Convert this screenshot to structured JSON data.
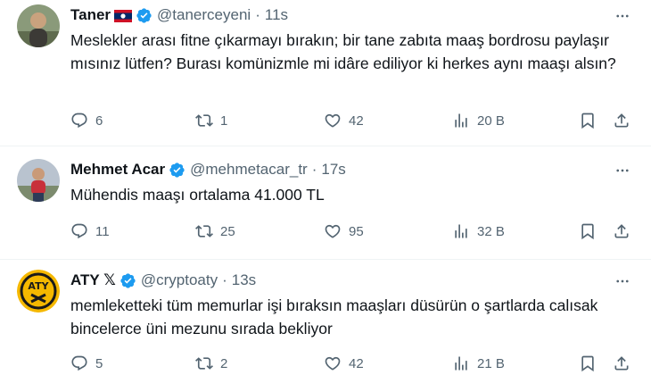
{
  "tweets": [
    {
      "name": "Taner",
      "handle": "@tanerceyeni",
      "time": "11s",
      "text": "Meslekler arası fitne çıkarmayı bırakın; bir tane zabıta maaş bordrosu paylaşır mısınız lütfen? Burası komünizmle mi idâre ediliyor ki herkes aynı maaşı alsın?",
      "replies": "6",
      "reposts": "1",
      "likes": "42",
      "views": "20 B"
    },
    {
      "name": "Mehmet Acar",
      "handle": "@mehmetacar_tr",
      "time": "17s",
      "text": "Mühendis maaşı ortalama 41.000 TL",
      "replies": "11",
      "reposts": "25",
      "likes": "95",
      "views": "32 B"
    },
    {
      "name": "ATY 𝕏",
      "handle": "@cryptoaty",
      "time": "13s",
      "text": "memleketteki tüm memurlar işi bıraksın maaşları düsürün o şartlarda calısak bincelerce üni mezunu sırada bekliyor",
      "replies": "5",
      "reposts": "2",
      "likes": "42",
      "views": "21 B"
    }
  ],
  "sep": "·",
  "colors": {
    "verified": "#1d9bf0",
    "muted": "#536471",
    "text": "#0f1419"
  },
  "icons": [
    "reply-icon",
    "repost-icon",
    "like-icon",
    "views-icon",
    "bookmark-icon",
    "share-icon",
    "more-icon",
    "verified-badge-icon"
  ]
}
